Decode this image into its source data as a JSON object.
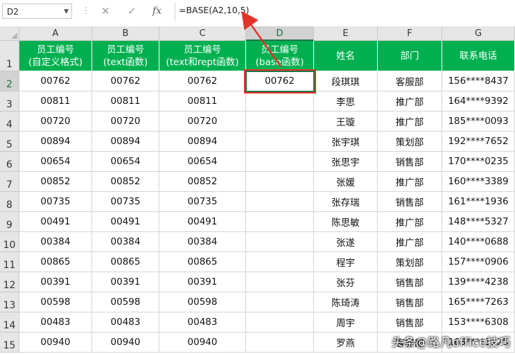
{
  "formula_bar": {
    "name_box": "D2",
    "cancel_icon": "✕",
    "enter_icon": "✓",
    "fx_label": "fx",
    "formula": "=BASE(A2,10,5)"
  },
  "columns": [
    "A",
    "B",
    "C",
    "D",
    "E",
    "F",
    "G"
  ],
  "header_row_number": "1",
  "headers": [
    [
      "员工编号",
      "(自定义格式)"
    ],
    [
      "员工编号",
      "(text函数)"
    ],
    [
      "员工编号",
      "(text和rept函数)"
    ],
    [
      "员工编号",
      "(base函数)"
    ],
    [
      "姓名",
      ""
    ],
    [
      "部门",
      ""
    ],
    [
      "联系电话",
      ""
    ]
  ],
  "rows": [
    {
      "n": "2",
      "cells": [
        "00762",
        "00762",
        "00762",
        "00762",
        "段琪琪",
        "客服部",
        "156****8437"
      ]
    },
    {
      "n": "3",
      "cells": [
        "00811",
        "00811",
        "00811",
        "",
        "李思",
        "推广部",
        "164****9392"
      ]
    },
    {
      "n": "4",
      "cells": [
        "00720",
        "00720",
        "00720",
        "",
        "王璇",
        "推广部",
        "185****0093"
      ]
    },
    {
      "n": "5",
      "cells": [
        "00894",
        "00894",
        "00894",
        "",
        "张宇琪",
        "策划部",
        "192****7652"
      ]
    },
    {
      "n": "6",
      "cells": [
        "00654",
        "00654",
        "00654",
        "",
        "张思宇",
        "销售部",
        "170****0235"
      ]
    },
    {
      "n": "7",
      "cells": [
        "00852",
        "00852",
        "00852",
        "",
        "张媛",
        "推广部",
        "160****3389"
      ]
    },
    {
      "n": "8",
      "cells": [
        "00735",
        "00735",
        "00735",
        "",
        "张存瑞",
        "销售部",
        "161****1936"
      ]
    },
    {
      "n": "9",
      "cells": [
        "00491",
        "00491",
        "00491",
        "",
        "陈思敏",
        "推广部",
        "148****5327"
      ]
    },
    {
      "n": "10",
      "cells": [
        "00384",
        "00384",
        "00384",
        "",
        "张遂",
        "推广部",
        "140****0688"
      ]
    },
    {
      "n": "11",
      "cells": [
        "00865",
        "00865",
        "00865",
        "",
        "程宇",
        "策划部",
        "157****0906"
      ]
    },
    {
      "n": "12",
      "cells": [
        "00391",
        "00391",
        "00391",
        "",
        "张芬",
        "销售部",
        "139****4238"
      ]
    },
    {
      "n": "13",
      "cells": [
        "00598",
        "00598",
        "00598",
        "",
        "陈琦涛",
        "销售部",
        "165****7263"
      ]
    },
    {
      "n": "14",
      "cells": [
        "00483",
        "00483",
        "00483",
        "",
        "周宇",
        "销售部",
        "153****6308"
      ]
    },
    {
      "n": "15",
      "cells": [
        "00940",
        "00940",
        "00940",
        "",
        "罗燕",
        "客服部",
        "163****1125"
      ]
    }
  ],
  "watermark": "头条@路凡office技巧",
  "colors": {
    "header_green": "#00b050",
    "selection": "#217346",
    "annotation_red": "#e6332a"
  }
}
